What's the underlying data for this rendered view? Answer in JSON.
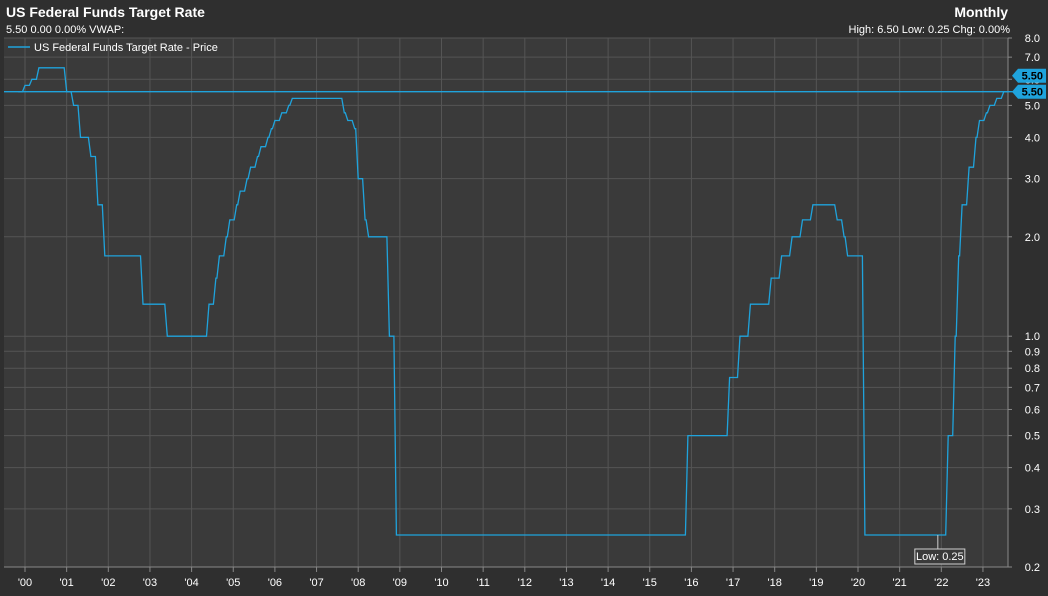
{
  "header": {
    "title": "US Federal Funds Target Rate",
    "frequency": "Monthly",
    "quote_line": "5.50 0.00 0.00%  VWAP:",
    "stats_line": "High: 6.50 Low: 0.25 Chg: 0.00%"
  },
  "colors": {
    "background": "#2f2f2f",
    "plot_background": "#3a3a3a",
    "grid": "#555555",
    "line": "#1fa3dc",
    "tag": "#1fa3dc"
  },
  "chart_data": {
    "type": "line",
    "title": "US Federal Funds Target Rate",
    "y_scale": "log",
    "ylim": [
      0.2,
      8.0
    ],
    "xlim": [
      "2000-01",
      "2023-12"
    ],
    "grid": true,
    "legend_position": "top-left",
    "y_ticks": [
      "8.0",
      "7.0",
      "6.0",
      "5.0",
      "4.0",
      "3.0",
      "2.0",
      "1.0",
      "0.9",
      "0.8",
      "0.7",
      "0.6",
      "0.5",
      "0.4",
      "0.3",
      "0.2"
    ],
    "x_ticks": [
      "'00",
      "'01",
      "'02",
      "'03",
      "'04",
      "'05",
      "'06",
      "'07",
      "'08",
      "'09",
      "'10",
      "'11",
      "'12",
      "'13",
      "'14",
      "'15",
      "'16",
      "'17",
      "'18",
      "'19",
      "'20",
      "'21",
      "'22",
      "'23"
    ],
    "series": [
      {
        "name": "US Federal Funds Target Rate - Price",
        "points": [
          [
            "1999-11",
            5.5
          ],
          [
            "2000-01",
            5.75
          ],
          [
            "2000-03",
            6.0
          ],
          [
            "2000-05",
            6.5
          ],
          [
            "2001-01",
            5.5
          ],
          [
            "2001-03",
            5.0
          ],
          [
            "2001-05",
            4.0
          ],
          [
            "2001-08",
            3.5
          ],
          [
            "2001-10",
            2.5
          ],
          [
            "2001-12",
            1.75
          ],
          [
            "2002-11",
            1.25
          ],
          [
            "2003-06",
            1.0
          ],
          [
            "2004-06",
            1.25
          ],
          [
            "2004-08",
            1.5
          ],
          [
            "2004-09",
            1.75
          ],
          [
            "2004-11",
            2.0
          ],
          [
            "2004-12",
            2.25
          ],
          [
            "2005-02",
            2.5
          ],
          [
            "2005-03",
            2.75
          ],
          [
            "2005-05",
            3.0
          ],
          [
            "2005-06",
            3.25
          ],
          [
            "2005-08",
            3.5
          ],
          [
            "2005-09",
            3.75
          ],
          [
            "2005-11",
            4.0
          ],
          [
            "2005-12",
            4.25
          ],
          [
            "2006-01",
            4.5
          ],
          [
            "2006-03",
            4.75
          ],
          [
            "2006-05",
            5.0
          ],
          [
            "2006-06",
            5.25
          ],
          [
            "2007-09",
            4.75
          ],
          [
            "2007-10",
            4.5
          ],
          [
            "2007-12",
            4.25
          ],
          [
            "2008-01",
            3.0
          ],
          [
            "2008-03",
            2.25
          ],
          [
            "2008-04",
            2.0
          ],
          [
            "2008-10",
            1.0
          ],
          [
            "2008-12",
            0.25
          ],
          [
            "2015-12",
            0.5
          ],
          [
            "2016-12",
            0.75
          ],
          [
            "2017-03",
            1.0
          ],
          [
            "2017-06",
            1.25
          ],
          [
            "2017-12",
            1.5
          ],
          [
            "2018-03",
            1.75
          ],
          [
            "2018-06",
            2.0
          ],
          [
            "2018-09",
            2.25
          ],
          [
            "2018-12",
            2.5
          ],
          [
            "2019-07",
            2.25
          ],
          [
            "2019-09",
            2.0
          ],
          [
            "2019-10",
            1.75
          ],
          [
            "2020-03",
            0.25
          ],
          [
            "2022-03",
            0.5
          ],
          [
            "2022-05",
            1.0
          ],
          [
            "2022-06",
            1.75
          ],
          [
            "2022-07",
            2.5
          ],
          [
            "2022-09",
            3.25
          ],
          [
            "2022-11",
            4.0
          ],
          [
            "2022-12",
            4.5
          ],
          [
            "2023-02",
            4.75
          ],
          [
            "2023-03",
            5.0
          ],
          [
            "2023-05",
            5.25
          ],
          [
            "2023-07",
            5.5
          ],
          [
            "2023-12",
            5.5
          ]
        ]
      }
    ],
    "reference_line": 5.5,
    "price_tags": [
      "5.50",
      "5.50"
    ],
    "annotations": [
      {
        "text": "Low: 0.25",
        "x": "2021-12",
        "y": 0.25
      }
    ]
  }
}
